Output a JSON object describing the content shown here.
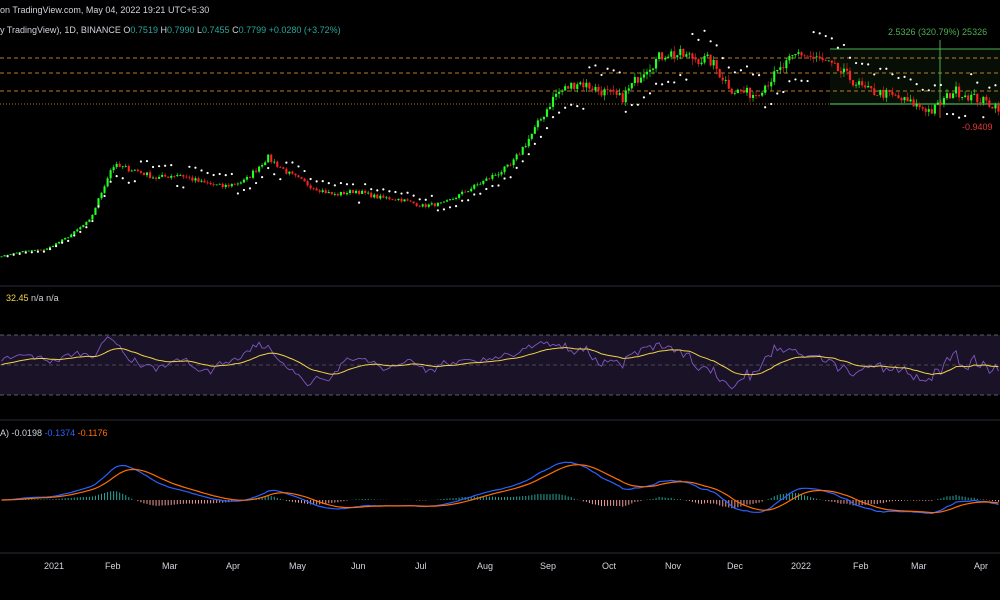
{
  "header": {
    "published": "on TradingView.com, May 04, 2022 19:21 UTC+5:30",
    "symbol_info": "y TradingView), 1D, BINANCE",
    "open_label": "O",
    "open": "0.7519",
    "high_label": "H",
    "high": "0.7990",
    "low_label": "L",
    "low": "0.7455",
    "close_label": "C",
    "close": "0.7799",
    "change": "+0.0280 (+3.72%)"
  },
  "measure": {
    "up_label": "2.5326 (320.79%) 25326",
    "down_label": "-0.9409"
  },
  "rsi": {
    "value": "32.45",
    "na1": "n/a",
    "na2": "n/a"
  },
  "macd": {
    "prefix": "A)",
    "hist": "-0.0198",
    "macd": "-0.1374",
    "signal": "-0.1176"
  },
  "colors": {
    "up": "#26a69a",
    "down": "#ef5350",
    "bright_up": "#22ff22",
    "bright_down": "#ff2222",
    "sar": "#ffffff",
    "rsi_line": "#7e57c2",
    "rsi_ma": "#f0d34a",
    "macd_line": "#2962ff",
    "signal_line": "#ff6d00",
    "level_orange": "#f7a13a",
    "measure_green": "#4caf50"
  },
  "x_axis": {
    "ticks": [
      "2021",
      "Feb",
      "Mar",
      "Apr",
      "May",
      "Jun",
      "Jul",
      "Aug",
      "Sep",
      "Oct",
      "Nov",
      "Dec",
      "2022",
      "Feb",
      "Mar",
      "Apr"
    ]
  },
  "chart_data": {
    "type": "candlestick",
    "price_anchors": [
      0.12,
      0.18,
      0.2,
      0.35,
      0.55,
      1.2,
      1.15,
      1.05,
      1.1,
      1.0,
      0.95,
      1.02,
      1.3,
      1.1,
      0.95,
      0.85,
      0.9,
      0.82,
      0.8,
      0.72,
      0.75,
      0.9,
      1.05,
      1.2,
      1.6,
      2.05,
      2.2,
      2.1,
      2.0,
      2.35,
      2.55,
      2.5,
      2.45,
      2.1,
      2.05,
      2.3,
      2.55,
      2.45,
      2.3,
      2.1,
      2.05,
      1.95,
      1.85,
      2.1,
      2.0,
      1.9
    ],
    "rsi_levels": [
      70,
      50,
      30
    ],
    "macd_zero": 0
  }
}
